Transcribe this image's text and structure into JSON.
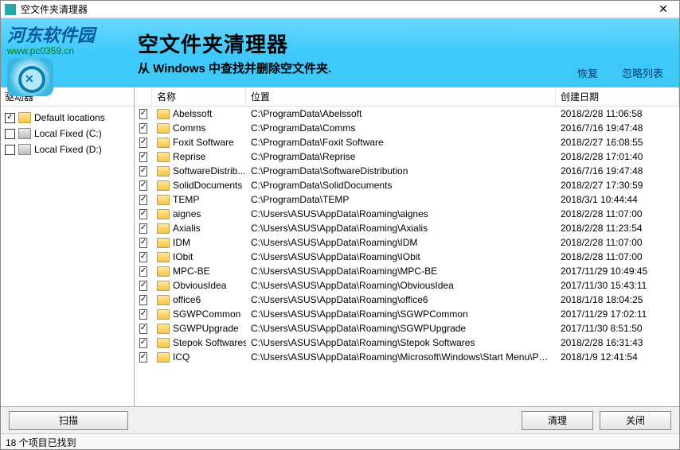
{
  "window": {
    "title": "空文件夹清理器"
  },
  "banner": {
    "logo_text": "河东软件园",
    "logo_url": "www.pc0359.cn",
    "title": "空文件夹清理器",
    "subtitle": "从 Windows 中查找并删除空文件夹.",
    "link_restore": "恢复",
    "link_ignore": "忽略列表"
  },
  "sidebar": {
    "header": "驱动器",
    "items": [
      {
        "checked": true,
        "icon": "folder",
        "label": "Default locations"
      },
      {
        "checked": false,
        "icon": "hdd",
        "label": "Local Fixed (C:)"
      },
      {
        "checked": false,
        "icon": "hdd",
        "label": "Local Fixed (D:)"
      }
    ]
  },
  "list": {
    "headers": {
      "name": "名称",
      "location": "位置",
      "date": "创建日期"
    },
    "rows": [
      {
        "checked": true,
        "name": "Abelssoft",
        "location": "C:\\ProgramData\\Abelssoft",
        "date": "2018/2/28 11:06:58"
      },
      {
        "checked": true,
        "name": "Comms",
        "location": "C:\\ProgramData\\Comms",
        "date": "2016/7/16 19:47:48"
      },
      {
        "checked": true,
        "name": "Foxit Software",
        "location": "C:\\ProgramData\\Foxit Software",
        "date": "2018/2/27 16:08:55"
      },
      {
        "checked": true,
        "name": "Reprise",
        "location": "C:\\ProgramData\\Reprise",
        "date": "2018/2/28 17:01:40"
      },
      {
        "checked": true,
        "name": "SoftwareDistrib...",
        "location": "C:\\ProgramData\\SoftwareDistribution",
        "date": "2016/7/16 19:47:48"
      },
      {
        "checked": true,
        "name": "SolidDocuments",
        "location": "C:\\ProgramData\\SolidDocuments",
        "date": "2018/2/27 17:30:59"
      },
      {
        "checked": true,
        "name": "TEMP",
        "location": "C:\\ProgramData\\TEMP",
        "date": "2018/3/1 10:44:44"
      },
      {
        "checked": true,
        "name": "aignes",
        "location": "C:\\Users\\ASUS\\AppData\\Roaming\\aignes",
        "date": "2018/2/28 11:07:00"
      },
      {
        "checked": true,
        "name": "Axialis",
        "location": "C:\\Users\\ASUS\\AppData\\Roaming\\Axialis",
        "date": "2018/2/28 11:23:54"
      },
      {
        "checked": true,
        "name": "IDM",
        "location": "C:\\Users\\ASUS\\AppData\\Roaming\\IDM",
        "date": "2018/2/28 11:07:00"
      },
      {
        "checked": true,
        "name": "IObit",
        "location": "C:\\Users\\ASUS\\AppData\\Roaming\\IObit",
        "date": "2018/2/28 11:07:00"
      },
      {
        "checked": true,
        "name": "MPC-BE",
        "location": "C:\\Users\\ASUS\\AppData\\Roaming\\MPC-BE",
        "date": "2017/11/29 10:49:45"
      },
      {
        "checked": true,
        "name": "ObviousIdea",
        "location": "C:\\Users\\ASUS\\AppData\\Roaming\\ObviousIdea",
        "date": "2017/11/30 15:43:11"
      },
      {
        "checked": true,
        "name": "office6",
        "location": "C:\\Users\\ASUS\\AppData\\Roaming\\office6",
        "date": "2018/1/18 18:04:25"
      },
      {
        "checked": true,
        "name": "SGWPCommon",
        "location": "C:\\Users\\ASUS\\AppData\\Roaming\\SGWPCommon",
        "date": "2017/11/29 17:02:11"
      },
      {
        "checked": true,
        "name": "SGWPUpgrade",
        "location": "C:\\Users\\ASUS\\AppData\\Roaming\\SGWPUpgrade",
        "date": "2017/11/30 8:51:50"
      },
      {
        "checked": true,
        "name": "Stepok Softwares",
        "location": "C:\\Users\\ASUS\\AppData\\Roaming\\Stepok Softwares",
        "date": "2018/2/28 16:31:43"
      },
      {
        "checked": true,
        "name": "ICQ",
        "location": "C:\\Users\\ASUS\\AppData\\Roaming\\Microsoft\\Windows\\Start Menu\\Programs...",
        "date": "2018/1/9 12:41:54"
      }
    ]
  },
  "buttons": {
    "scan": "扫描",
    "clean": "清理",
    "close": "关闭"
  },
  "status": "18 个项目已找到"
}
